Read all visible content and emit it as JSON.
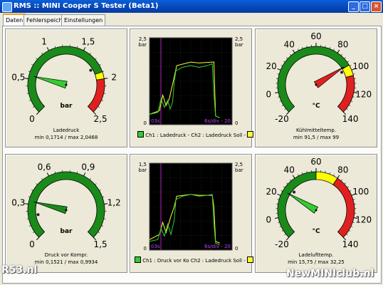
{
  "window": {
    "title": "RMS :: MINI Cooper S Tester (Beta1)",
    "min": "_",
    "max": "□",
    "close": "×"
  },
  "tabs": [
    {
      "label": "Daten"
    },
    {
      "label": "Fehlerspeicher"
    },
    {
      "label": "Einstellungen"
    }
  ],
  "gauges": [
    {
      "name": "Ladedruck",
      "minmax": "min 0,1714 / max 2,0468",
      "unit": "bar",
      "ticks": [
        "0",
        "0,5",
        "1",
        "1,5",
        "2",
        "2,5"
      ],
      "value": 0.55,
      "range": [
        0,
        2.5
      ],
      "zones": [
        {
          "from": 0,
          "to": 1.9,
          "color": "#1a8a1a"
        },
        {
          "from": 1.9,
          "to": 2.0,
          "color": "#ffff00"
        },
        {
          "from": 2.0,
          "to": 2.5,
          "color": "#e02020"
        }
      ],
      "needle_color": "#33cc33",
      "marker": 1.8
    },
    {
      "name": "Kühlmitteltemp.",
      "minmax": "min 91,5 / max 99",
      "unit": "°C",
      "ticks": [
        "-20",
        "0",
        "20",
        "40",
        "60",
        "80",
        "100",
        "120",
        "140"
      ],
      "value": 94,
      "range": [
        -20,
        140
      ],
      "zones": [
        {
          "from": -20,
          "to": 95,
          "color": "#1a8a1a"
        },
        {
          "from": 95,
          "to": 105,
          "color": "#ffff00"
        },
        {
          "from": 105,
          "to": 140,
          "color": "#e02020"
        }
      ],
      "needle_color": "#e02020",
      "marker": 98
    },
    {
      "name": "Druck vor Kompr.",
      "minmax": "min 0,1521 / max 0,9934",
      "unit": "bar",
      "ticks": [
        "0",
        "0,3",
        "0,6",
        "0,9",
        "1,2",
        "1,5"
      ],
      "value": 0.33,
      "range": [
        0,
        1.5
      ],
      "zones": [
        {
          "from": 0,
          "to": 1.5,
          "color": "#1a8a1a"
        }
      ],
      "needle_color": "#1a8a1a",
      "marker": 0.2
    },
    {
      "name": "Ladelufttemp.",
      "minmax": "min 15,75 / max 32,25",
      "unit": "°C",
      "ticks": [
        "-20",
        "0",
        "20",
        "40",
        "60",
        "80",
        "100",
        "120",
        "140"
      ],
      "value": 25,
      "range": [
        -20,
        140
      ],
      "zones": [
        {
          "from": -20,
          "to": 60,
          "color": "#1a8a1a"
        },
        {
          "from": 60,
          "to": 80,
          "color": "#ffff00"
        },
        {
          "from": 80,
          "to": 140,
          "color": "#e02020"
        }
      ],
      "needle_color": "#33cc33",
      "marker": 30
    }
  ],
  "charts": [
    {
      "legend": "Ch1 : Ladedruck - Ch2 : Ladedruck Soll -",
      "ch1_color": "#33cc33",
      "ch2_color": "#ffff33",
      "ytop": "2,5",
      "yunit": "bar",
      "ybottom": "0",
      "right_top": "2,5",
      "right_unit": "bar",
      "right_bottom": "0",
      "time_left": "03s",
      "time_right": "6s/div - 20"
    },
    {
      "legend": "Ch1 : Druck vor Ko Ch2 : Ladedruck Soll -",
      "ch1_color": "#33cc33",
      "ch2_color": "#ffff33",
      "ytop": "1,5",
      "yunit": "bar",
      "ybottom": "0",
      "right_top": "2,5",
      "right_unit": "bar",
      "right_bottom": "0",
      "time_left": "03s",
      "time_right": "6s/div - 20"
    }
  ],
  "watermarks": {
    "left": "R53.nl",
    "right": "NewMINIclub.nl"
  }
}
